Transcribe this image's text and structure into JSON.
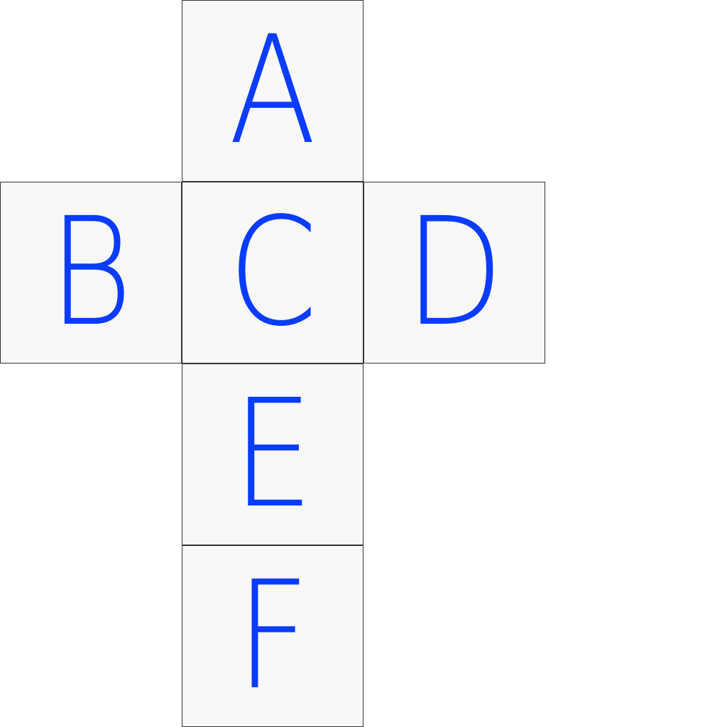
{
  "faces": {
    "a": {
      "label": "A"
    },
    "b": {
      "label": "B"
    },
    "c": {
      "label": "C"
    },
    "d": {
      "label": "D"
    },
    "e": {
      "label": "E"
    },
    "f": {
      "label": "F"
    }
  },
  "colors": {
    "letter": "#0a3cff",
    "face_fill": "#f8f8f8",
    "border": "#333333",
    "background": "#ffffff"
  }
}
